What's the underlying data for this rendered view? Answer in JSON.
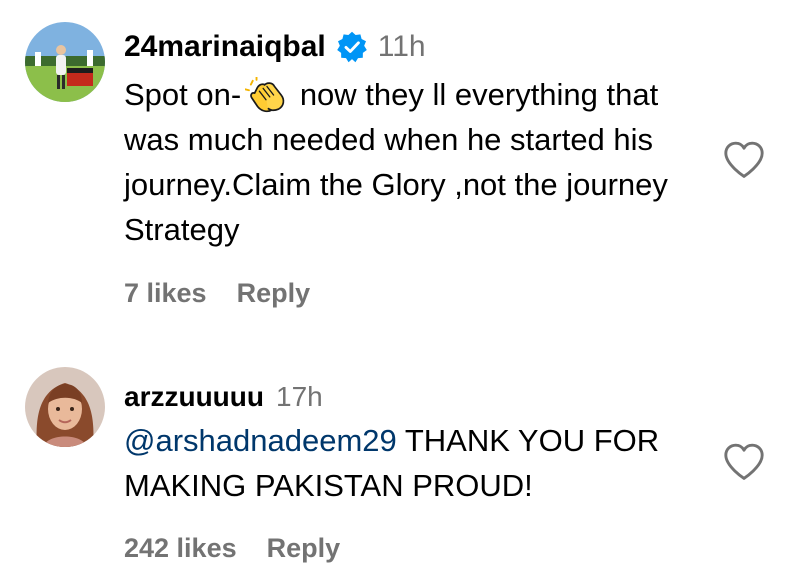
{
  "comments": [
    {
      "username": "24marinaiqbal",
      "verified": true,
      "time": "11h",
      "text_before_emoji": "Spot on-",
      "emoji": "clapping-hands-emoji",
      "text_after_emoji": " now they ll everything that was much needed when he started his journey.Claim the Glory ,not the journey Strategy",
      "likes": "7 likes",
      "reply_label": "Reply"
    },
    {
      "username": "arzzuuuuu",
      "verified": false,
      "time": "17h",
      "mention": "@arshadnadeem29",
      "text": " THANK YOU FOR MAKING PAKISTAN PROUD!",
      "likes": "242 likes",
      "reply_label": "Reply"
    }
  ],
  "colors": {
    "verified_badge": "#0095f6",
    "mention": "#00376b",
    "secondary_text": "#737373"
  }
}
